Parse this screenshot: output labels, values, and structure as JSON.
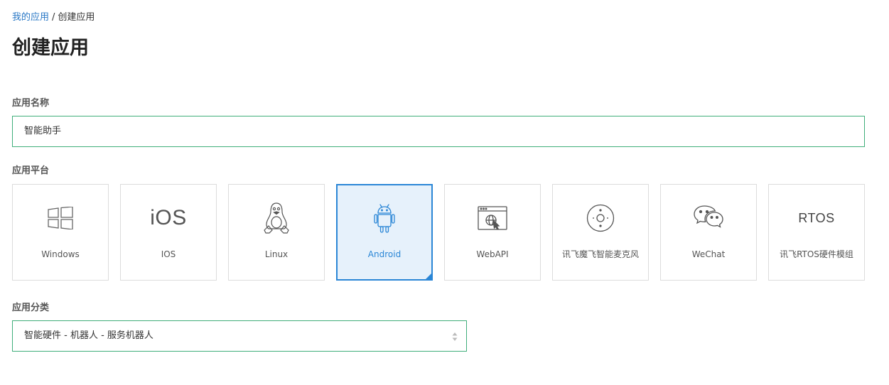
{
  "breadcrumb": {
    "parent": "我的应用",
    "separator": "/",
    "current": "创建应用"
  },
  "page_title": "创建应用",
  "app_name": {
    "label": "应用名称",
    "value": "智能助手"
  },
  "platform": {
    "label": "应用平台",
    "selected": "Android",
    "options": [
      {
        "name": "Windows",
        "icon": "windows-icon"
      },
      {
        "name": "IOS",
        "icon": "ios-icon",
        "glyph": "iOS"
      },
      {
        "name": "Linux",
        "icon": "linux-icon"
      },
      {
        "name": "Android",
        "icon": "android-icon"
      },
      {
        "name": "WebAPI",
        "icon": "webapi-icon"
      },
      {
        "name": "讯飞魔飞智能麦克风",
        "icon": "microphone-icon"
      },
      {
        "name": "WeChat",
        "icon": "wechat-icon"
      },
      {
        "name": "讯飞RTOS硬件模组",
        "icon": "rtos-icon",
        "glyph": "RTOS"
      }
    ]
  },
  "category": {
    "label": "应用分类",
    "value": "智能硬件 - 机器人 - 服务机器人"
  },
  "colors": {
    "accent_green": "#3fae7a",
    "selected_blue": "#2a86d6",
    "link_blue": "#2a78c6"
  }
}
